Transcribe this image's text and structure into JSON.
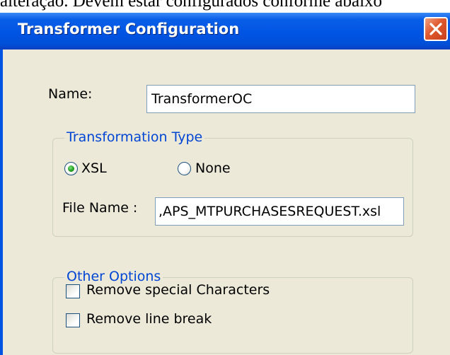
{
  "background_text": "alteração. Devem estar configurados conforme abaixo",
  "window": {
    "title": "Transformer Configuration"
  },
  "form": {
    "name_label": "Name:",
    "name_value": "TransformerOC",
    "transformation_group": {
      "legend": "Transformation Type",
      "options": [
        {
          "label": "XSL",
          "selected": true
        },
        {
          "label": "None",
          "selected": false
        }
      ],
      "file_name_label": "File Name :",
      "file_name_value": ",APS_MTPURCHASESREQUEST.xsl"
    },
    "other_options_group": {
      "legend": "Other Options",
      "checkboxes": [
        {
          "label": "Remove special Characters",
          "checked": false
        },
        {
          "label": "Remove line break",
          "checked": false
        }
      ]
    }
  },
  "colors": {
    "titlebar": "#0054e3",
    "dialog_bg": "#ece9d8",
    "group_legend": "#0046d5",
    "close_button": "#e0582e"
  },
  "icons": {
    "close": "close-icon"
  }
}
